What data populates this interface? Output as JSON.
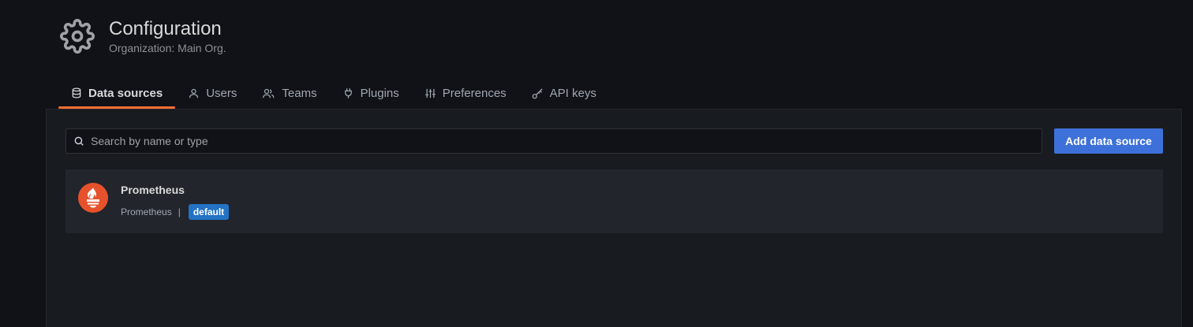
{
  "header": {
    "title": "Configuration",
    "subtitle": "Organization: Main Org.",
    "icon": "gear-icon"
  },
  "tabs": [
    {
      "label": "Data sources",
      "icon": "database-icon",
      "active": true
    },
    {
      "label": "Users",
      "icon": "user-icon",
      "active": false
    },
    {
      "label": "Teams",
      "icon": "users-icon",
      "active": false
    },
    {
      "label": "Plugins",
      "icon": "plug-icon",
      "active": false
    },
    {
      "label": "Preferences",
      "icon": "sliders-icon",
      "active": false
    },
    {
      "label": "API keys",
      "icon": "key-icon",
      "active": false
    }
  ],
  "search": {
    "placeholder": "Search by name or type",
    "value": ""
  },
  "add_button": {
    "label": "Add data source"
  },
  "datasources": [
    {
      "name": "Prometheus",
      "type": "Prometheus",
      "separator": "|",
      "badge": "default",
      "logo": "prometheus-logo-icon"
    }
  ],
  "colors": {
    "background": "#111217",
    "panel": "#181b1f",
    "card": "#22252b",
    "accent_tab": "#f46f31",
    "primary_button": "#3d71d9",
    "badge": "#2372c4",
    "prometheus": "#e6522c"
  }
}
